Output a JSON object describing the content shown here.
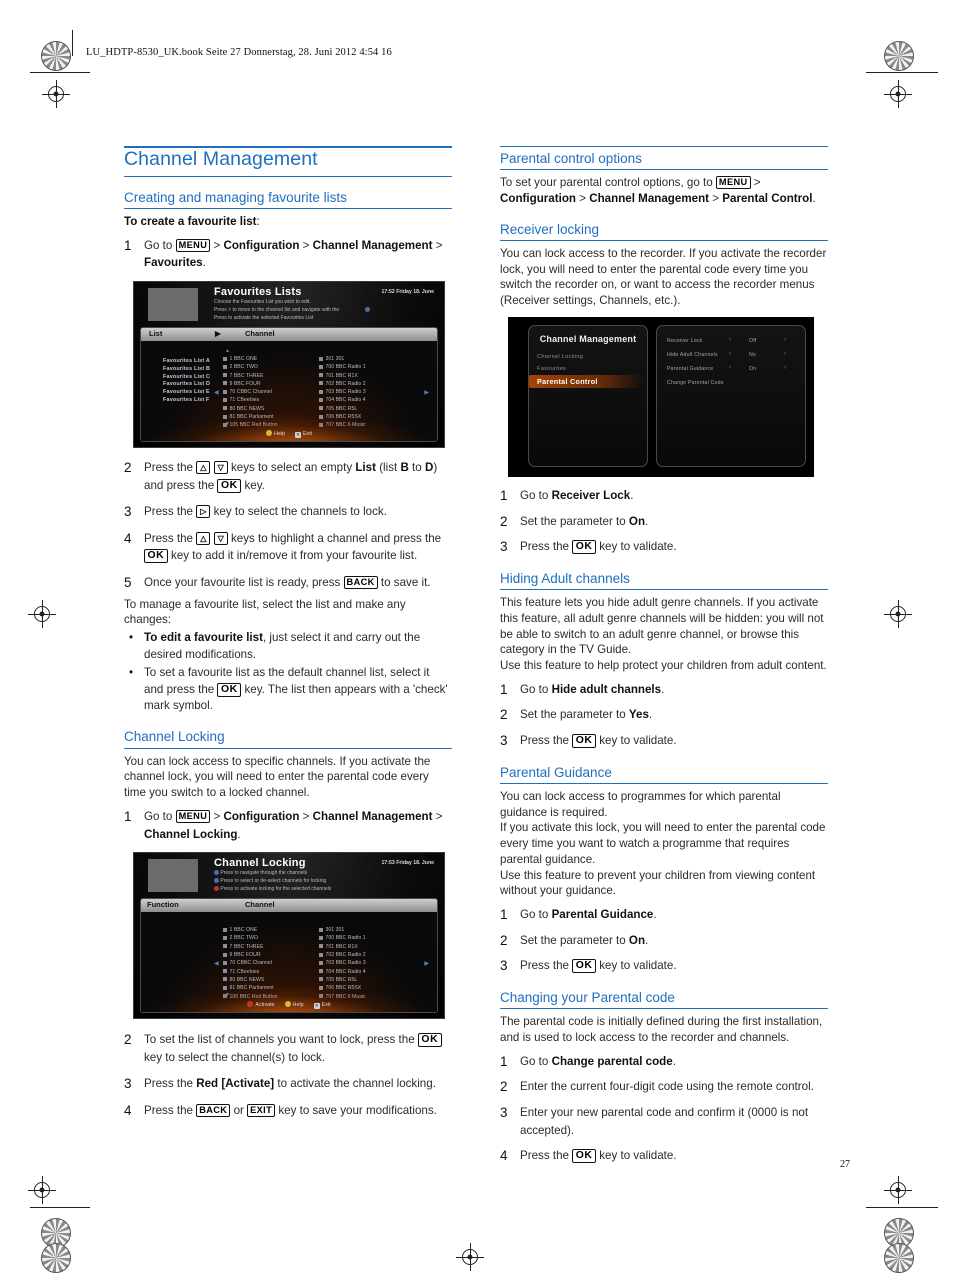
{
  "page": {
    "file_header": "LU_HDTP-8530_UK.book  Seite 27  Donnerstag, 28. Juni 2012  4:54 16",
    "page_number": "27"
  },
  "left_column": {
    "title": "Channel Management",
    "sections": [
      {
        "heading": "Creating and managing favourite lists",
        "intro_bold": "To create a favourite list",
        "intro_tail": ":",
        "steps": [
          {
            "num": "1",
            "parts": [
              {
                "t": "text",
                "v": "Go to "
              },
              {
                "t": "key",
                "v": "MENU"
              },
              {
                "t": "text",
                "v": " > "
              },
              {
                "t": "bold",
                "v": "Configuration"
              },
              {
                "t": "text",
                "v": " > "
              },
              {
                "t": "bold",
                "v": "Channel Management"
              },
              {
                "t": "text",
                "v": " > "
              },
              {
                "t": "bold",
                "v": "Favourites"
              },
              {
                "t": "text",
                "v": "."
              }
            ]
          },
          {
            "num": "2",
            "parts": [
              {
                "t": "text",
                "v": "Press the "
              },
              {
                "t": "key-arrow",
                "v": "△"
              },
              {
                "t": "text",
                "v": " "
              },
              {
                "t": "key-arrow",
                "v": "▽"
              },
              {
                "t": "text",
                "v": " keys to select an empty "
              },
              {
                "t": "bold",
                "v": "List"
              },
              {
                "t": "text",
                "v": " (list "
              },
              {
                "t": "bold",
                "v": "B"
              },
              {
                "t": "text",
                "v": " to "
              },
              {
                "t": "bold",
                "v": "D"
              },
              {
                "t": "text",
                "v": ") and press the "
              },
              {
                "t": "key-ok",
                "v": "OK"
              },
              {
                "t": "text",
                "v": " key."
              }
            ]
          },
          {
            "num": "3",
            "parts": [
              {
                "t": "text",
                "v": "Press the "
              },
              {
                "t": "key-arrow",
                "v": "▷"
              },
              {
                "t": "text",
                "v": " key to select the channels to lock."
              }
            ]
          },
          {
            "num": "4",
            "parts": [
              {
                "t": "text",
                "v": "Press the "
              },
              {
                "t": "key-arrow",
                "v": "△"
              },
              {
                "t": "text",
                "v": " "
              },
              {
                "t": "key-arrow",
                "v": "▽"
              },
              {
                "t": "text",
                "v": " keys to highlight a channel and press the "
              },
              {
                "t": "key-ok",
                "v": "OK"
              },
              {
                "t": "text",
                "v": " key to add it in/remove it from your favourite list."
              }
            ]
          },
          {
            "num": "5",
            "parts": [
              {
                "t": "text",
                "v": "Once your favourite list is ready, press "
              },
              {
                "t": "key",
                "v": "BACK"
              },
              {
                "t": "text",
                "v": " to save it."
              }
            ]
          }
        ],
        "manage_line": "To manage a favourite list, select the list and make any changes:",
        "bullets": [
          [
            {
              "t": "bold",
              "v": "To edit a favourite list"
            },
            {
              "t": "text",
              "v": ", just select it and carry out the desired modifications."
            }
          ],
          [
            {
              "t": "text",
              "v": "To set a favourite list as the default channel list, select it and press the "
            },
            {
              "t": "key-ok",
              "v": "OK"
            },
            {
              "t": "text",
              "v": " key. The list then appears with a 'check' mark symbol."
            }
          ]
        ]
      },
      {
        "heading": "Channel Locking",
        "body": "You can lock access to specific channels. If you activate the channel lock, you will need to enter the parental code every time you switch to a locked channel.",
        "steps_before_image": [
          {
            "num": "1",
            "parts": [
              {
                "t": "text",
                "v": "Go to "
              },
              {
                "t": "key",
                "v": "MENU"
              },
              {
                "t": "text",
                "v": " > "
              },
              {
                "t": "bold",
                "v": "Configuration"
              },
              {
                "t": "text",
                "v": " > "
              },
              {
                "t": "bold",
                "v": "Channel Management"
              },
              {
                "t": "text",
                "v": " > "
              },
              {
                "t": "bold",
                "v": "Channel Locking"
              },
              {
                "t": "text",
                "v": "."
              }
            ]
          }
        ],
        "steps_after_image": [
          {
            "num": "2",
            "parts": [
              {
                "t": "text",
                "v": "To set the list of channels you want to lock, press the "
              },
              {
                "t": "key-ok",
                "v": "OK"
              },
              {
                "t": "text",
                "v": " key to select the channel(s) to lock."
              }
            ]
          },
          {
            "num": "3",
            "parts": [
              {
                "t": "text",
                "v": "Press the "
              },
              {
                "t": "bold",
                "v": "Red [Activate]"
              },
              {
                "t": "text",
                "v": " to activate the channel locking."
              }
            ]
          },
          {
            "num": "4",
            "parts": [
              {
                "t": "text",
                "v": "Press the "
              },
              {
                "t": "key",
                "v": "BACK"
              },
              {
                "t": "text",
                "v": " or "
              },
              {
                "t": "key",
                "v": "EXIT"
              },
              {
                "t": "text",
                "v": " key to save your modifications."
              }
            ]
          }
        ]
      }
    ]
  },
  "right_column": {
    "sections": [
      {
        "heading": "Parental control options",
        "intro_parts": [
          {
            "t": "text",
            "v": "To set your parental control options, go to "
          },
          {
            "t": "key",
            "v": "MENU"
          },
          {
            "t": "text",
            "v": " > "
          },
          {
            "t": "bold",
            "v": "Configuration"
          },
          {
            "t": "text",
            "v": " > "
          },
          {
            "t": "bold",
            "v": "Channel Management"
          },
          {
            "t": "text",
            "v": " > "
          },
          {
            "t": "bold",
            "v": "Parental Control"
          },
          {
            "t": "text",
            "v": "."
          }
        ]
      },
      {
        "heading": "Receiver locking",
        "body": "You can lock access to the recorder. If you activate the recorder lock, you will need to enter the parental code every time you switch the recorder on, or want to access the recorder menus (Receiver settings, Channels, etc.).",
        "steps": [
          {
            "num": "1",
            "parts": [
              {
                "t": "text",
                "v": "Go to "
              },
              {
                "t": "bold",
                "v": "Receiver Lock"
              },
              {
                "t": "text",
                "v": "."
              }
            ]
          },
          {
            "num": "2",
            "parts": [
              {
                "t": "text",
                "v": "Set the parameter to "
              },
              {
                "t": "bold",
                "v": "On"
              },
              {
                "t": "text",
                "v": "."
              }
            ]
          },
          {
            "num": "3",
            "parts": [
              {
                "t": "text",
                "v": "Press the "
              },
              {
                "t": "key-ok",
                "v": "OK"
              },
              {
                "t": "text",
                "v": " key to validate."
              }
            ]
          }
        ]
      },
      {
        "heading": "Hiding Adult channels",
        "body": "This feature lets you hide adult genre channels. If you activate this feature, all adult genre channels will be hidden: you will not be able to switch to an adult genre channel, or browse this category in the TV Guide.",
        "body2": "Use this feature to help protect your children from adult content.",
        "steps": [
          {
            "num": "1",
            "parts": [
              {
                "t": "text",
                "v": "Go to "
              },
              {
                "t": "bold",
                "v": "Hide adult channels"
              },
              {
                "t": "text",
                "v": "."
              }
            ]
          },
          {
            "num": "2",
            "parts": [
              {
                "t": "text",
                "v": "Set the parameter to "
              },
              {
                "t": "bold",
                "v": "Yes"
              },
              {
                "t": "text",
                "v": "."
              }
            ]
          },
          {
            "num": "3",
            "parts": [
              {
                "t": "text",
                "v": "Press the "
              },
              {
                "t": "key-ok",
                "v": "OK"
              },
              {
                "t": "text",
                "v": " key to validate."
              }
            ]
          }
        ]
      },
      {
        "heading": "Parental Guidance",
        "body": "You can lock access to programmes for which parental guidance is required.",
        "body2": "If you activate this lock, you will need to enter the parental code every time you want to watch a programme that requires parental guidance.",
        "body3": "Use this feature to prevent your children from viewing content without your guidance.",
        "steps": [
          {
            "num": "1",
            "parts": [
              {
                "t": "text",
                "v": "Go to "
              },
              {
                "t": "bold",
                "v": "Parental Guidance"
              },
              {
                "t": "text",
                "v": "."
              }
            ]
          },
          {
            "num": "2",
            "parts": [
              {
                "t": "text",
                "v": "Set the parameter to "
              },
              {
                "t": "bold",
                "v": "On"
              },
              {
                "t": "text",
                "v": "."
              }
            ]
          },
          {
            "num": "3",
            "parts": [
              {
                "t": "text",
                "v": "Press the "
              },
              {
                "t": "key-ok",
                "v": "OK"
              },
              {
                "t": "text",
                "v": " key to validate."
              }
            ]
          }
        ]
      },
      {
        "heading": "Changing your Parental code",
        "body": "The parental code is initially defined during the first installation, and is used to lock access to the recorder and channels.",
        "steps": [
          {
            "num": "1",
            "parts": [
              {
                "t": "text",
                "v": "Go to "
              },
              {
                "t": "bold",
                "v": "Change parental code"
              },
              {
                "t": "text",
                "v": "."
              }
            ]
          },
          {
            "num": "2",
            "parts": [
              {
                "t": "text",
                "v": "Enter the current four-digit code using the remote control."
              }
            ]
          },
          {
            "num": "3",
            "parts": [
              {
                "t": "text",
                "v": "Enter your new parental code and confirm it (0000 is not accepted)."
              }
            ]
          },
          {
            "num": "4",
            "parts": [
              {
                "t": "text",
                "v": "Press the "
              },
              {
                "t": "key-ok",
                "v": "OK"
              },
              {
                "t": "text",
                "v": " key to validate."
              }
            ]
          }
        ]
      }
    ]
  },
  "screenshot_favourites": {
    "title": "Favourites Lists",
    "clock": "17:52  Friday 18. June",
    "hints": [
      "Choose the Favourites List you wish to edit.",
      "Press  >  to move to the channel list and navigate with the",
      "Press      to activate the selected Favourites List"
    ],
    "col_headers": {
      "left": "List",
      "right": "Channel"
    },
    "lists": [
      "Favourites List A",
      "Favourites List B",
      "Favourites List C",
      "Favourites List D",
      "Favourites List E",
      "Favourites List F"
    ],
    "channels_col1": [
      "1  BBC ONE",
      "2  BBC TWO",
      "7  BBC THREE",
      "9  BBC FOUR",
      "70  CBBC Channel",
      "71  CBeebies",
      "80  BBC NEWS",
      "81  BBC Parliament",
      "105  BBC Red Button"
    ],
    "channels_col2": [
      "301  301",
      "700  BBC Radio 1",
      "701  BBC R1X",
      "702  BBC Radio 2",
      "703  BBC Radio 3",
      "704  BBC Radio 4",
      "705  BBC R5L",
      "706  BBC R5SX",
      "707  BBC 6 Music"
    ],
    "footer": [
      {
        "dot": "yellow",
        "label": "Help"
      },
      {
        "dot": "exit",
        "label": "Exit"
      }
    ]
  },
  "screenshot_channel_locking": {
    "title": "Channel Locking",
    "clock": "17:53  Friday 18. June",
    "hints": [
      "Press      to navigate through the channels",
      "Press      to select or de-select channels for locking",
      "Press      to activate locking for the selected channels"
    ],
    "col_headers": {
      "left": "Function",
      "right": "Channel"
    },
    "channels_col1": [
      "1  BBC ONE",
      "2  BBC TWO",
      "7  BBC THREE",
      "9  BBC FOUR",
      "70  CBBC Channel",
      "71  CBeebies",
      "80  BBC NEWS",
      "81  BBC Parliament",
      "105  BBC Red Button"
    ],
    "channels_col2": [
      "301  301",
      "700  BBC Radio 1",
      "701  BBC R1X",
      "702  BBC Radio 2",
      "703  BBC Radio 3",
      "704  BBC Radio 4",
      "705  BBC R5L",
      "706  BBC R5SX",
      "707  BBC 6 Music"
    ],
    "footer": [
      {
        "dot": "red",
        "label": "Activate"
      },
      {
        "dot": "yellow",
        "label": "Help"
      },
      {
        "dot": "exit",
        "label": "Exit"
      }
    ]
  },
  "screenshot_parental_menu": {
    "title": "Channel Management",
    "menu_items": [
      {
        "label": "Channel Locking",
        "selected": false
      },
      {
        "label": "Favourites",
        "selected": false
      },
      {
        "label": "Parental Control",
        "selected": true
      }
    ],
    "options": [
      {
        "label": "Receiver Lock",
        "value": "Off",
        "has_arrows": true
      },
      {
        "label": "Hide Adult Channels",
        "value": "No",
        "has_arrows": true
      },
      {
        "label": "Parental Guidance",
        "value": "On",
        "has_arrows": true
      },
      {
        "label": "Change Parental Code",
        "value": "",
        "has_arrows": false
      }
    ]
  },
  "colors": {
    "heading_blue": "#1f6ec0",
    "body_text": "#2b2b2b",
    "highlight_orange": "#a34409"
  }
}
